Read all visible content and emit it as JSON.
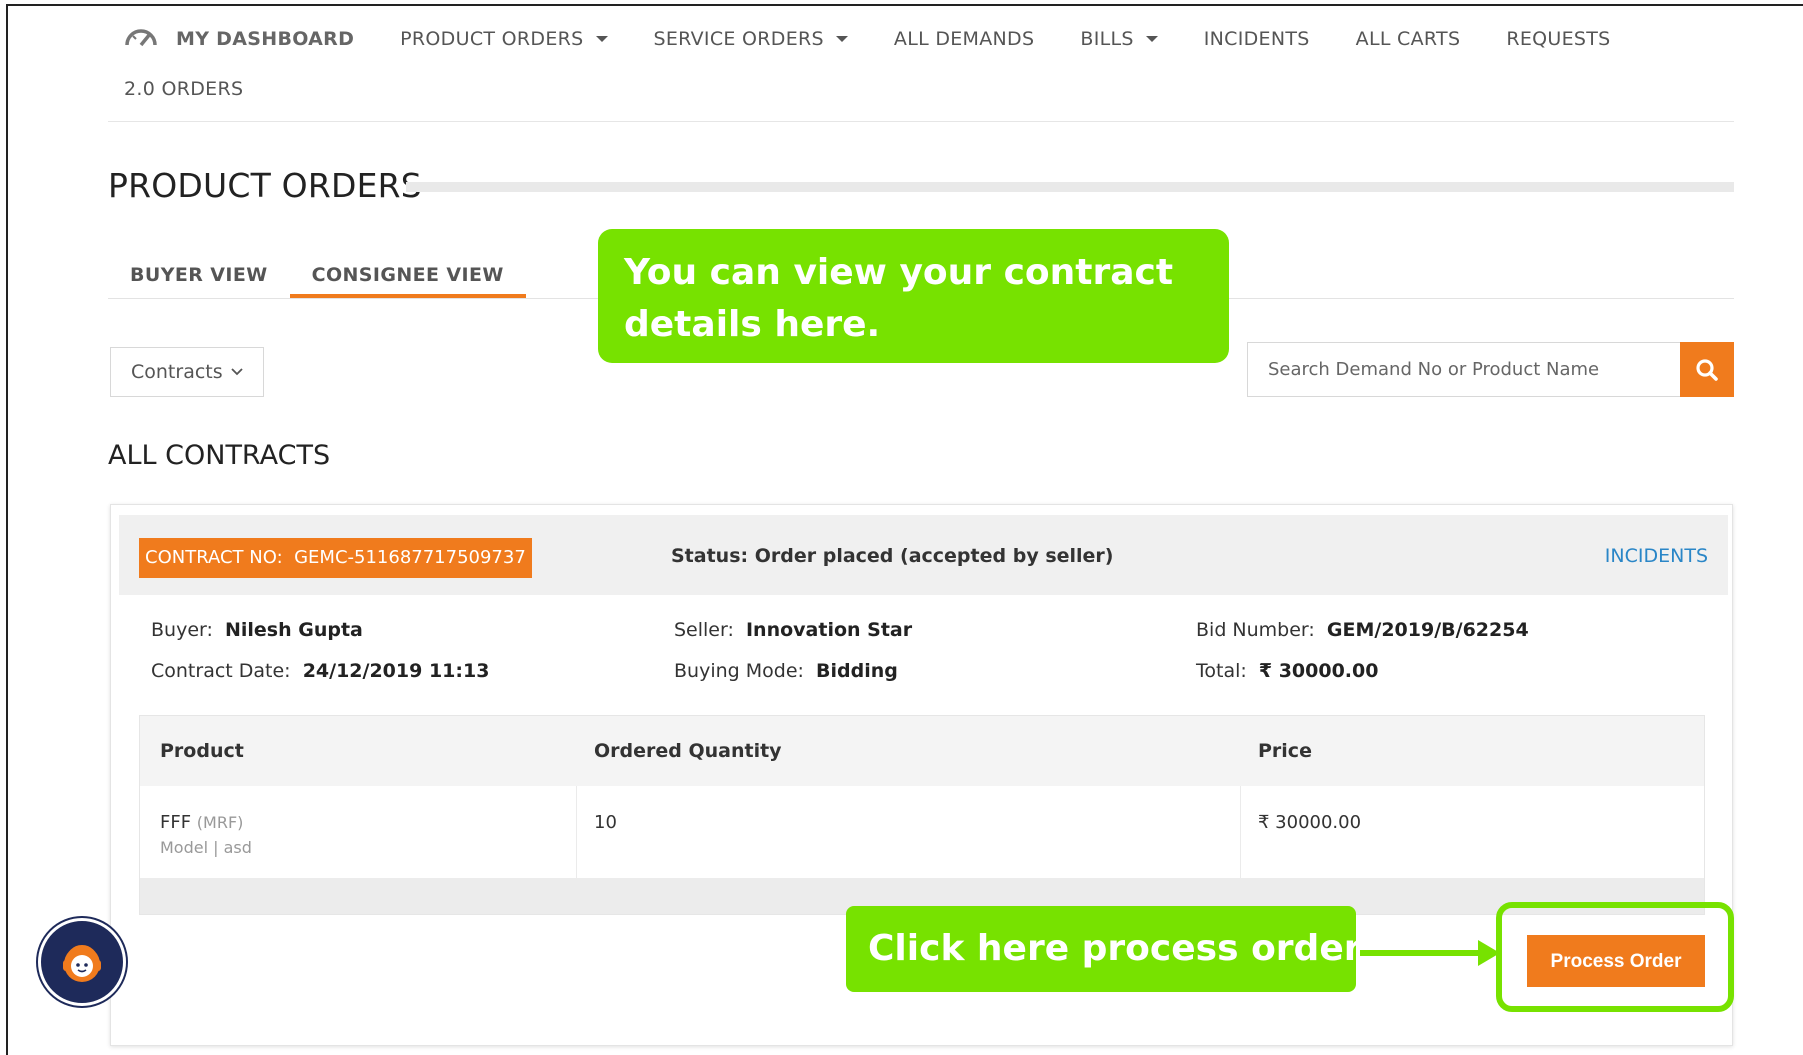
{
  "nav": {
    "dashboard_label": "MY DASHBOARD",
    "items": [
      {
        "label": "PRODUCT ORDERS"
      },
      {
        "label": "SERVICE ORDERS"
      },
      {
        "label": "ALL DEMANDS"
      },
      {
        "label": "BILLS"
      },
      {
        "label": "INCIDENTS"
      },
      {
        "label": "ALL CARTS"
      },
      {
        "label": "REQUESTS"
      }
    ],
    "row2_item": "2.0 ORDERS"
  },
  "page": {
    "title": "PRODUCT ORDERS",
    "tabs": [
      {
        "label": "BUYER VIEW"
      },
      {
        "label": "CONSIGNEE VIEW",
        "active": true
      }
    ],
    "filter_label": "Contracts",
    "search_placeholder": "Search Demand No or Product Name",
    "section_title": "ALL CONTRACTS"
  },
  "tooltips": {
    "contract_hint_line1": "You can view your contract",
    "contract_hint_line2": "details here.",
    "process_hint": "Click here process order."
  },
  "contract": {
    "badge_label": "CONTRACT NO:",
    "number": "GEMC-511687717509737",
    "status": "Status: Order placed (accepted by seller)",
    "incidents_link": "INCIDENTS",
    "buyer_label": "Buyer:",
    "buyer": "Nilesh Gupta",
    "contract_date_label": "Contract Date:",
    "contract_date": "24/12/2019 11:13",
    "seller_label": "Seller:",
    "seller": "Innovation Star",
    "buying_mode_label": "Buying Mode:",
    "buying_mode": "Bidding",
    "bid_number_label": "Bid Number:",
    "bid_number": "GEM/2019/B/62254",
    "total_label": "Total:",
    "total": "₹  30000.00",
    "table": {
      "headers": [
        "Product",
        "Ordered Quantity",
        "Price"
      ],
      "rows": [
        {
          "product": "FFF",
          "product_tag": "(MRF)",
          "product_sub": "Model | asd",
          "quantity": "10",
          "price": "₹  30000.00"
        }
      ]
    },
    "process_button": "Process Order"
  },
  "colors": {
    "accent_orange": "#f07b1d",
    "tooltip_green": "#77e200",
    "link_blue": "#2a86c7"
  }
}
